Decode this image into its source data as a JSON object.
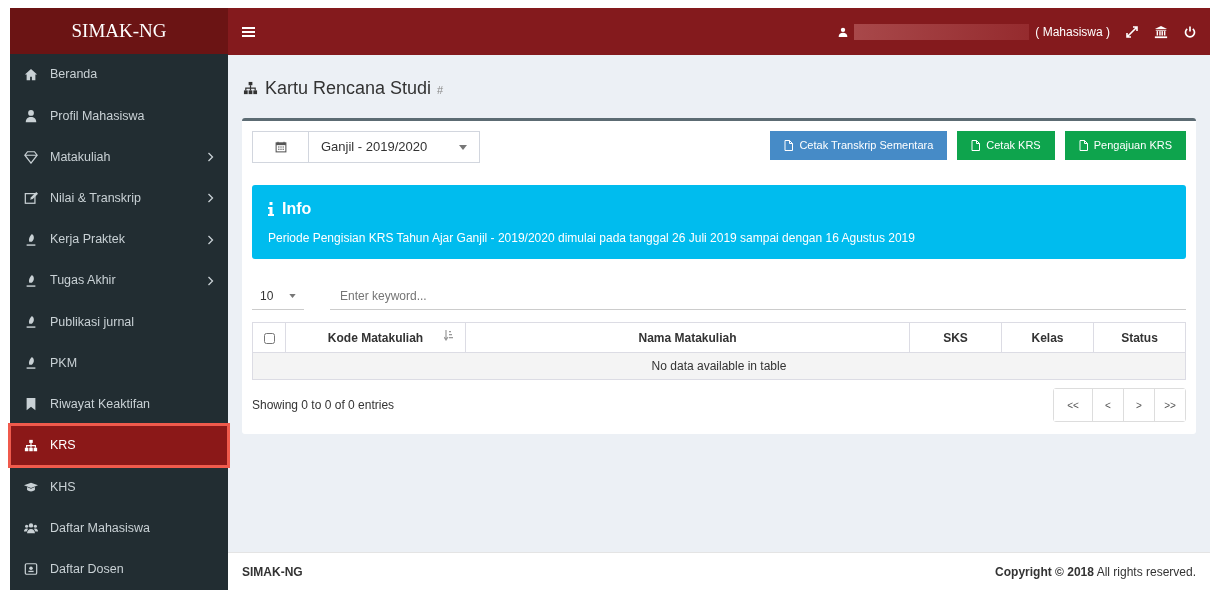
{
  "brand": "SIMAK-NG",
  "topbar": {
    "role": "( Mahasiswa )"
  },
  "sidebar": {
    "items": [
      {
        "label": "Beranda",
        "expandable": false,
        "selected": false,
        "highlighted": false
      },
      {
        "label": "Profil Mahasiswa",
        "expandable": false,
        "selected": false,
        "highlighted": false
      },
      {
        "label": "Matakuliah",
        "expandable": true,
        "selected": false,
        "highlighted": false
      },
      {
        "label": "Nilai & Transkrip",
        "expandable": true,
        "selected": false,
        "highlighted": false
      },
      {
        "label": "Kerja Praktek",
        "expandable": true,
        "selected": false,
        "highlighted": false
      },
      {
        "label": "Tugas Akhir",
        "expandable": true,
        "selected": false,
        "highlighted": false
      },
      {
        "label": "Publikasi jurnal",
        "expandable": false,
        "selected": false,
        "highlighted": false
      },
      {
        "label": "PKM",
        "expandable": false,
        "selected": false,
        "highlighted": false
      },
      {
        "label": "Riwayat Keaktifan",
        "expandable": false,
        "selected": false,
        "highlighted": false
      },
      {
        "label": "KRS",
        "expandable": false,
        "selected": true,
        "highlighted": true
      },
      {
        "label": "KHS",
        "expandable": false,
        "selected": false,
        "highlighted": false
      },
      {
        "label": "Daftar Mahasiswa",
        "expandable": false,
        "selected": false,
        "highlighted": false
      },
      {
        "label": "Daftar Dosen",
        "expandable": false,
        "selected": false,
        "highlighted": false
      }
    ]
  },
  "page": {
    "title": "Kartu Rencana Studi",
    "title_suffix": "#"
  },
  "toolbar": {
    "semester": "Ganjil - 2019/2020",
    "buttons": [
      {
        "label": "Cetak Transkrip Sementara",
        "kind": "info"
      },
      {
        "label": "Cetak KRS",
        "kind": "success"
      },
      {
        "label": "Pengajuan KRS",
        "kind": "success"
      }
    ]
  },
  "info": {
    "title": "Info",
    "text": "Periode Pengisian KRS Tahun Ajar Ganjil - 2019/2020 dimulai pada tanggal 26 Juli 2019 sampai dengan 16 Agustus 2019"
  },
  "table": {
    "page_size": "10",
    "search_placeholder": "Enter keyword...",
    "select_all_checked": false,
    "columns": [
      {
        "label": "Kode Matakuliah",
        "sortable": true
      },
      {
        "label": "Nama Matakuliah",
        "sortable": false
      },
      {
        "label": "SKS",
        "sortable": false
      },
      {
        "label": "Kelas",
        "sortable": false
      },
      {
        "label": "Status",
        "sortable": false
      }
    ],
    "empty_message": "No data available in table",
    "summary": "Showing 0 to 0 of 0 entries",
    "pagination": [
      "<<",
      "<",
      ">",
      ">>"
    ]
  },
  "footer": {
    "left": "SIMAK-NG",
    "right": "**Copyright © 2018** All rights reserved."
  }
}
